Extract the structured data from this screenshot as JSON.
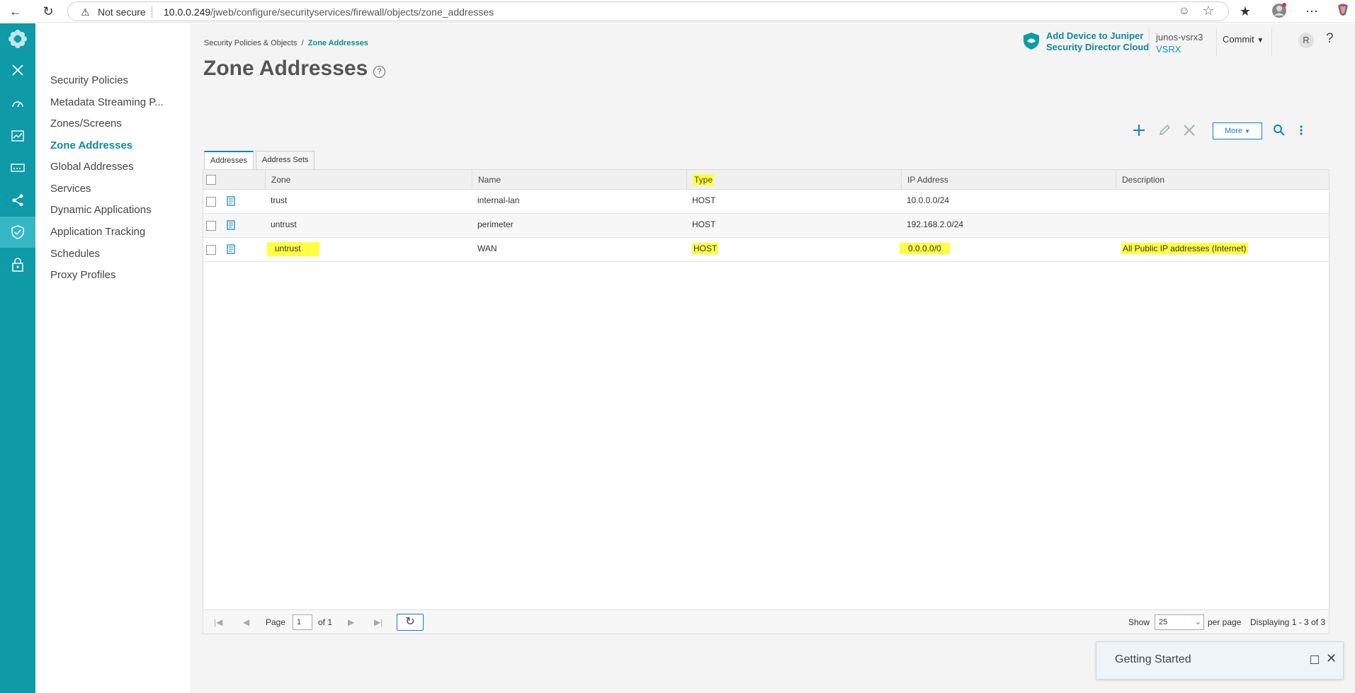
{
  "browser": {
    "not_secure": "Not secure",
    "url_host": "10.0.0.249",
    "url_path": "/jweb/configure/securityservices/firewall/objects/zone_addresses"
  },
  "sidebar": {
    "items": [
      {
        "label": "Security Policies"
      },
      {
        "label": "Metadata Streaming P..."
      },
      {
        "label": "Zones/Screens"
      },
      {
        "label": "Zone Addresses",
        "active": true
      },
      {
        "label": "Global Addresses"
      },
      {
        "label": "Services"
      },
      {
        "label": "Dynamic Applications"
      },
      {
        "label": "Application Tracking"
      },
      {
        "label": "Schedules"
      },
      {
        "label": "Proxy Profiles"
      }
    ]
  },
  "breadcrumb": {
    "parent": "Security Policies & Objects",
    "separator": "/",
    "current": "Zone Addresses"
  },
  "page_title": "Zone Addresses",
  "header": {
    "sd_line1": "Add Device to Juniper",
    "sd_line2": "Security Director Cloud",
    "device_name": "junos-vsrx3",
    "device_model": "VSRX",
    "commit_label": "Commit",
    "avatar_initial": "R",
    "help_label": "?"
  },
  "toolbar": {
    "more_label": "More"
  },
  "tabs": [
    {
      "label": "Addresses",
      "active": true
    },
    {
      "label": "Address Sets"
    }
  ],
  "table": {
    "columns": [
      "Zone",
      "Name",
      "Type",
      "IP Address",
      "Description"
    ],
    "rows": [
      {
        "zone": "trust",
        "name": "internal-lan",
        "type": "HOST",
        "ip": "10.0.0.0/24",
        "description": ""
      },
      {
        "zone": "untrust",
        "name": "perimeter",
        "type": "HOST",
        "ip": "192.168.2.0/24",
        "description": ""
      },
      {
        "zone": "untrust",
        "name": "WAN",
        "type": "HOST",
        "ip": "0.0.0.0/0",
        "description": "All Public IP addresses (Internet)"
      }
    ]
  },
  "pager": {
    "page_label": "Page",
    "page_value": "1",
    "of_label": "of 1",
    "show_label": "Show",
    "show_value": "25",
    "per_page_label": "per page",
    "displaying": "Displaying 1 - 3 of 3"
  },
  "getting_started": {
    "title": "Getting Started"
  },
  "colors": {
    "accent": "#0e9aa7",
    "link_blue": "#0e7fcf",
    "highlight": "#ffff44"
  }
}
